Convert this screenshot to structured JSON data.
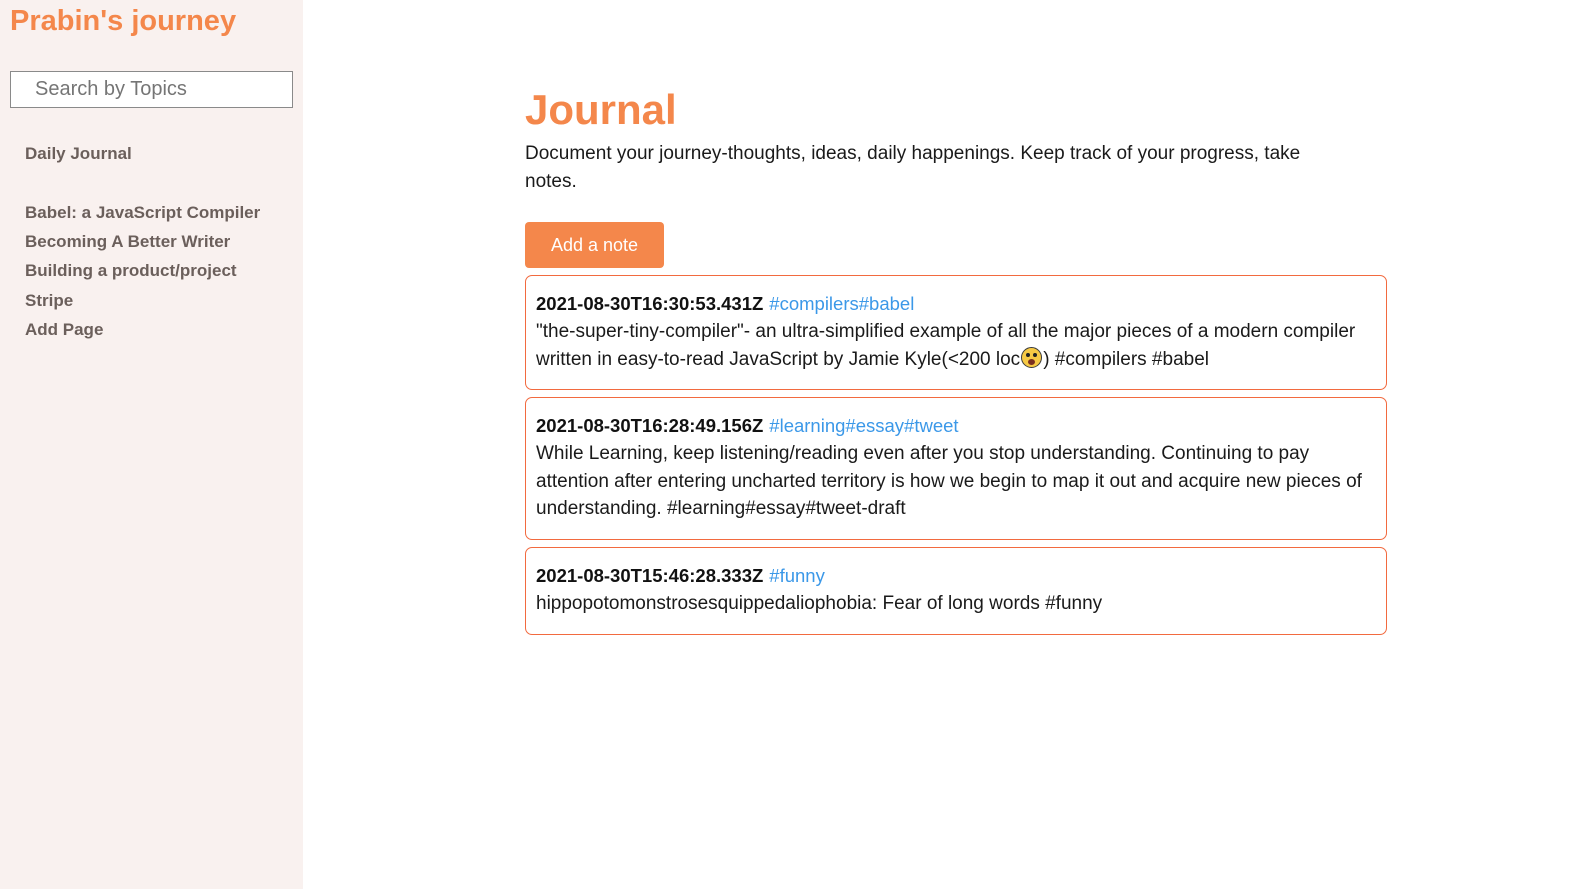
{
  "sidebar": {
    "site_title": "Prabin's journey",
    "search_placeholder": "Search by Topics",
    "items": [
      {
        "label": "Daily Journal"
      },
      {
        "label": "Babel: a JavaScript Compiler"
      },
      {
        "label": "Becoming A Better Writer"
      },
      {
        "label": "Building a product/project"
      },
      {
        "label": "Stripe"
      },
      {
        "label": "Add Page"
      }
    ]
  },
  "main": {
    "title": "Journal",
    "description": "Document your journey-thoughts, ideas, daily happenings. Keep track of your progress, take notes.",
    "add_button_label": "Add a note",
    "notes": [
      {
        "timestamp": "2021-08-30T16:30:53.431Z",
        "tags": "#compilers#babel",
        "text_before_emoji": "\"the-super-tiny-compiler\"- an ultra-simplified example of all the major pieces of a modern compiler written in easy-to-read JavaScript by Jamie Kyle(<200 loc",
        "emoji_icon": "astonished-face-icon",
        "text_after_emoji": ") #compilers #babel"
      },
      {
        "timestamp": "2021-08-30T16:28:49.156Z",
        "tags": "#learning#essay#tweet",
        "text": "While Learning, keep listening/reading even after you stop understanding. Continuing to pay attention after entering uncharted territory is how we begin to map it out and acquire new pieces of understanding. #learning#essay#tweet-draft"
      },
      {
        "timestamp": "2021-08-30T15:46:28.333Z",
        "tags": "#funny",
        "text": "hippopotomonstrosesquippedaliophobia: Fear of long words #funny"
      }
    ]
  },
  "colors": {
    "accent": "#f4874b",
    "note_border": "#f26a3f",
    "tag": "#3b98e8",
    "sidebar_bg": "#f9f1ef",
    "nav_text": "#6b5f5b"
  }
}
